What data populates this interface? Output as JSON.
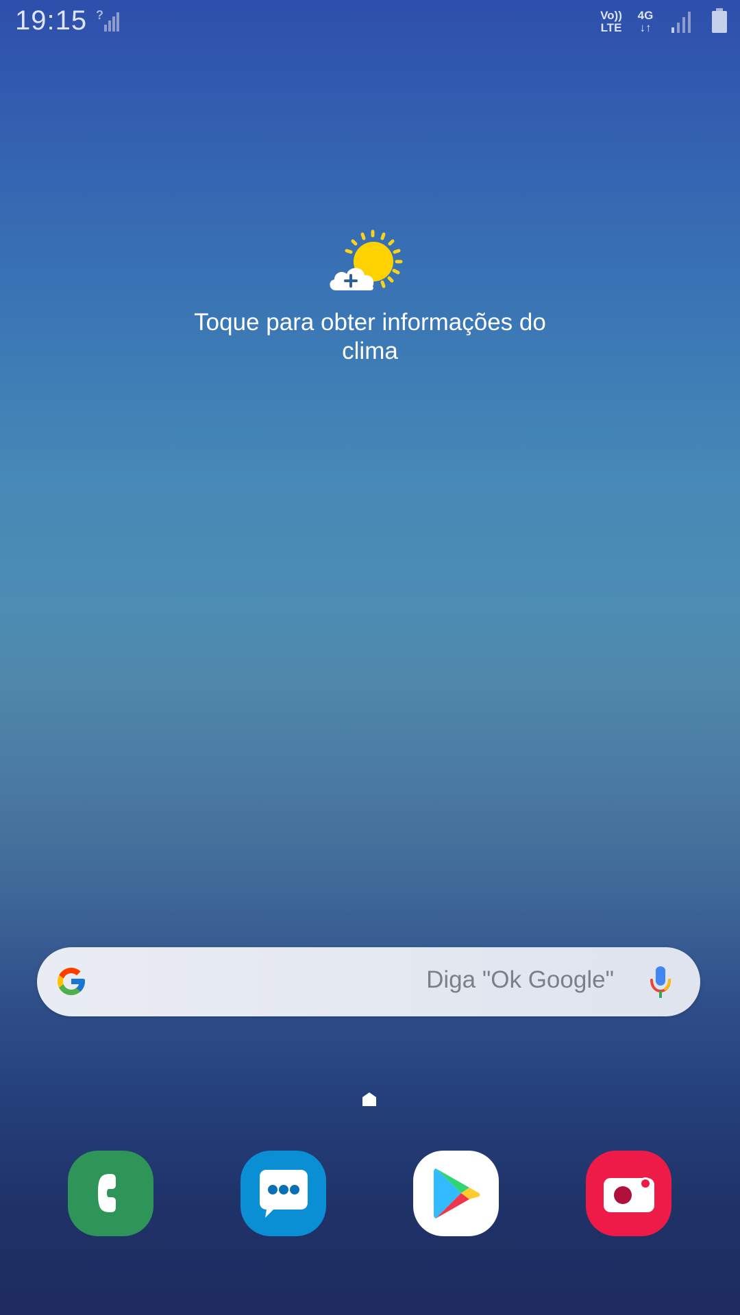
{
  "status_bar": {
    "time": "19:15",
    "volte_line1": "Vo))",
    "volte_line2": "LTE",
    "network": "4G",
    "network_arrows": "↓↑"
  },
  "weather": {
    "prompt": "Toque para obter informações do clima"
  },
  "search": {
    "hint": "Diga \"Ok Google\""
  },
  "dock": {
    "apps": [
      {
        "name": "Phone",
        "color": "#2f9457"
      },
      {
        "name": "Messages",
        "color": "#0a8fd4"
      },
      {
        "name": "Play Store",
        "color": "#ffffff"
      },
      {
        "name": "Camera",
        "color": "#ee1a48"
      }
    ]
  }
}
